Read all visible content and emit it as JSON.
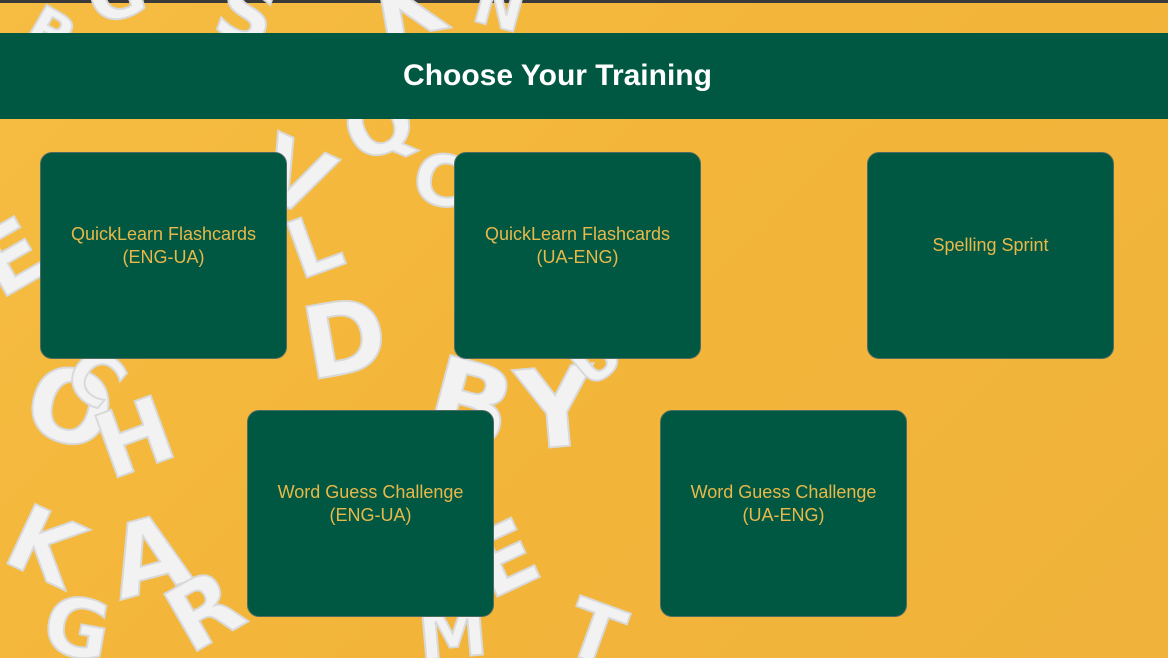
{
  "header": {
    "title": "Choose Your Training"
  },
  "trainings": [
    {
      "label": "QuickLearn Flashcards\n(ENG-UA)"
    },
    {
      "label": "QuickLearn Flashcards\n(UA-ENG)"
    },
    {
      "label": "Spelling Sprint"
    },
    {
      "label": "Word Guess Challenge\n(ENG-UA)"
    },
    {
      "label": "Word Guess Challenge\n(UA-ENG)"
    }
  ],
  "colors": {
    "header_bg": "#005842",
    "card_bg": "#005842",
    "card_text": "#e9b84a",
    "background": "#f3b63a"
  }
}
